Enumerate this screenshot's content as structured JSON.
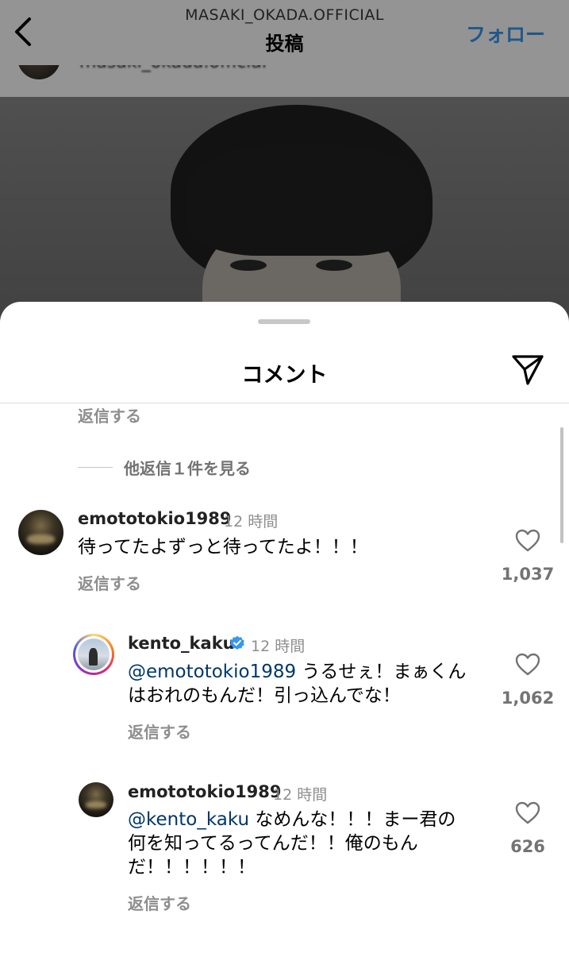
{
  "header": {
    "account": "MASAKI_OKADA.OFFICIAL",
    "title": "投稿",
    "follow_label": "フォロー"
  },
  "post": {
    "author_name": "masaki_okada.official"
  },
  "sheet": {
    "title": "コメント",
    "reply_label": "返信する",
    "more_replies_label": "他返信１件を見る"
  },
  "comments": [
    {
      "username": "emototokio1989",
      "time": "12 時間",
      "text": "待ってたよずっと待ってたよ！！！",
      "likes": "1,037"
    },
    {
      "username": "kento_kaku",
      "verified": true,
      "time": "12 時間",
      "mention": "@emototokio1989",
      "text_line1": " うるせぇ！まぁくん",
      "text_line2": "はおれのもんだ！引っ込んでな！",
      "likes": "1,062"
    },
    {
      "username": "emototokio1989",
      "time": "12 時間",
      "mention": "@kento_kaku",
      "text_line1": " なめんな！！！まー君の",
      "text_line2": "何を知ってるってんだ！！俺のもん",
      "text_line3": "だ！！！！！！",
      "likes": "626"
    }
  ],
  "colors": {
    "accent": "#3797f0",
    "mention": "#00376b",
    "muted": "#8e8e8e"
  },
  "icons": [
    "chevron-left-icon",
    "send-icon",
    "verified-badge-icon",
    "heart-icon"
  ]
}
